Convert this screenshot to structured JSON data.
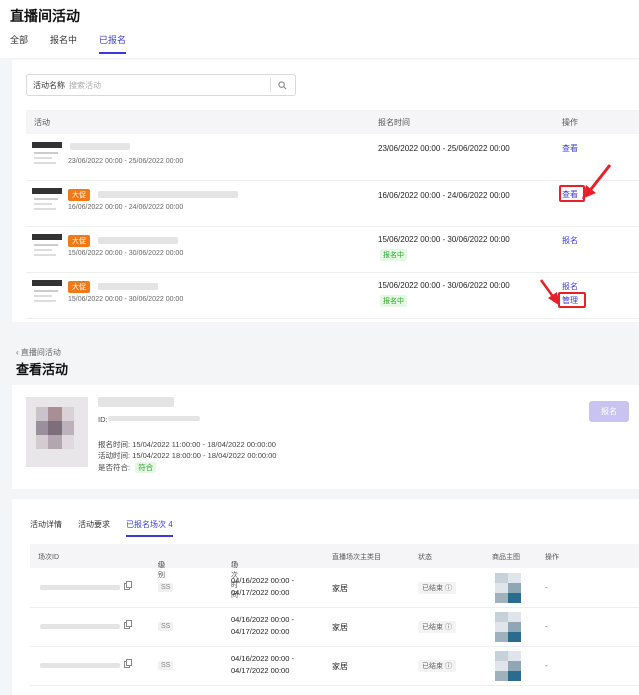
{
  "header": {
    "title": "直播间活动"
  },
  "tabs": [
    {
      "label": "全部"
    },
    {
      "label": "报名中"
    },
    {
      "label": "已报名"
    }
  ],
  "search": {
    "label": "活动名称",
    "placeholder": "搜索活动"
  },
  "table1": {
    "columns": [
      "活动",
      "报名时间",
      "操作"
    ],
    "rows": [
      {
        "badge": "",
        "date_range": "23/06/2022 00:00 - 25/06/2022 00:00",
        "reg_time": "23/06/2022 00:00 - 25/06/2022 00:00",
        "status_tag": "",
        "ops": [
          "查看"
        ]
      },
      {
        "badge": "大促",
        "date_range": "16/06/2022 00:00 - 24/06/2022 00:00",
        "reg_time": "16/06/2022 00:00 - 24/06/2022 00:00",
        "status_tag": "",
        "ops": [
          "查看"
        ]
      },
      {
        "badge": "大促",
        "date_range": "15/06/2022 00:00 - 30/06/2022 00:00",
        "reg_time": "15/06/2022 00:00 - 30/06/2022 00:00",
        "status_tag": "报名中",
        "ops": [
          "报名"
        ]
      },
      {
        "badge": "大促",
        "date_range": "15/06/2022 00:00 - 30/06/2022 00:00",
        "reg_time": "15/06/2022 00:00 - 30/06/2022 00:00",
        "status_tag": "报名中",
        "ops": [
          "报名",
          "管理"
        ]
      }
    ]
  },
  "detail": {
    "breadcrumb": "直播间活动",
    "title": "查看活动",
    "id_label": "ID:",
    "reg_time": "报名时间: 15/04/2022 11:00:00 - 18/04/2022 00:00:00",
    "act_time": "活动时间: 15/04/2022 18:00:00 - 18/04/2022 00:00:00",
    "eligible_label": "是否符合:",
    "eligible_tag": "符合",
    "register_button": "报名"
  },
  "detail_tabs": [
    {
      "label": "活动详情"
    },
    {
      "label": "活动要求"
    },
    {
      "label": "已报名场次 4"
    }
  ],
  "table2": {
    "columns": [
      "场次ID",
      "级别",
      "场次时间",
      "直播场次主类目",
      "状态",
      "商品主图",
      "操作"
    ],
    "rows": [
      {
        "level": "SS",
        "time1": "04/16/2022 00:00 -",
        "time2": "04/17/2022 00:00",
        "category": "家居",
        "status": "已结束",
        "op": "-"
      },
      {
        "level": "SS",
        "time1": "04/16/2022 00:00 -",
        "time2": "04/17/2022 00:00",
        "category": "家居",
        "status": "已结束",
        "op": "-"
      },
      {
        "level": "SS",
        "time1": "04/16/2022 00:00 -",
        "time2": "04/17/2022 00:00",
        "category": "家居",
        "status": "已结束",
        "op": "-"
      }
    ]
  },
  "colors": {
    "accent": "#3b3bd4",
    "orange": "#f07a1a",
    "green": "#2ba52b",
    "highlight": "#e8202a"
  }
}
